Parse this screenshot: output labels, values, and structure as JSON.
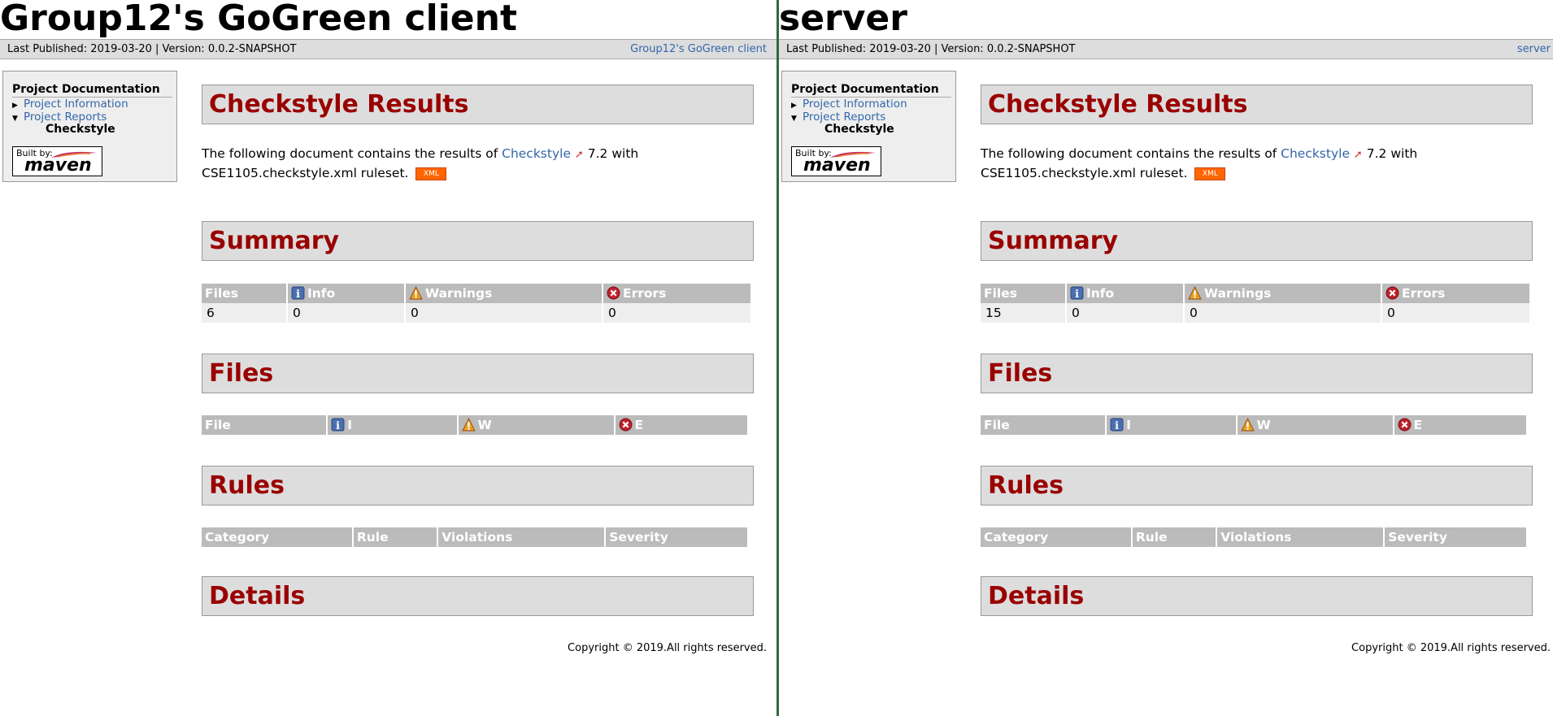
{
  "left": {
    "title": "Group12's GoGreen client",
    "breadcrumb": "Last Published: 2019-03-20  | Version: 0.0.2-SNAPSHOT",
    "breadcrumb_link": "Group12's GoGreen client",
    "summary": {
      "files": "6",
      "info": "0",
      "warnings": "0",
      "errors": "0"
    },
    "copyright": "Copyright © 2019.All rights reserved."
  },
  "right": {
    "title": "server",
    "breadcrumb": "Last Published: 2019-03-20  | Version: 0.0.2-SNAPSHOT",
    "breadcrumb_link": "server",
    "summary": {
      "files": "15",
      "info": "0",
      "warnings": "0",
      "errors": "0"
    },
    "copyright": "Copyright © 2019.All rights reserved."
  },
  "nav": {
    "heading": "Project Documentation",
    "project_information": "Project Information",
    "project_reports": "Project Reports",
    "current": "Checkstyle"
  },
  "badge": {
    "built_by": "Built by:",
    "maven": "maven"
  },
  "sections": {
    "results": "Checkstyle Results",
    "summary": "Summary",
    "files": "Files",
    "rules": "Rules",
    "details": "Details"
  },
  "intro": {
    "before": "The following document contains the results of ",
    "link": "Checkstyle",
    "after": " 7.2 with CSE1105.checkstyle.xml ruleset.",
    "xml": "XML"
  },
  "summary_headers": {
    "files": "Files",
    "info": "Info",
    "warnings": "Warnings",
    "errors": "Errors"
  },
  "files_headers": {
    "file": "File",
    "i": "I",
    "w": "W",
    "e": "E"
  },
  "rules_headers": {
    "category": "Category",
    "rule": "Rule",
    "violations": "Violations",
    "severity": "Severity"
  },
  "icons": {
    "info": "info-icon",
    "warning": "warning-icon",
    "error": "error-icon",
    "external": "external-link-icon",
    "expand": "triangle-right-icon",
    "collapse": "triangle-down-icon"
  },
  "colors": {
    "heading_red": "#990000",
    "link_blue": "#3366aa",
    "table_header": "#bbbbbb",
    "section_bg": "#dddddd"
  }
}
